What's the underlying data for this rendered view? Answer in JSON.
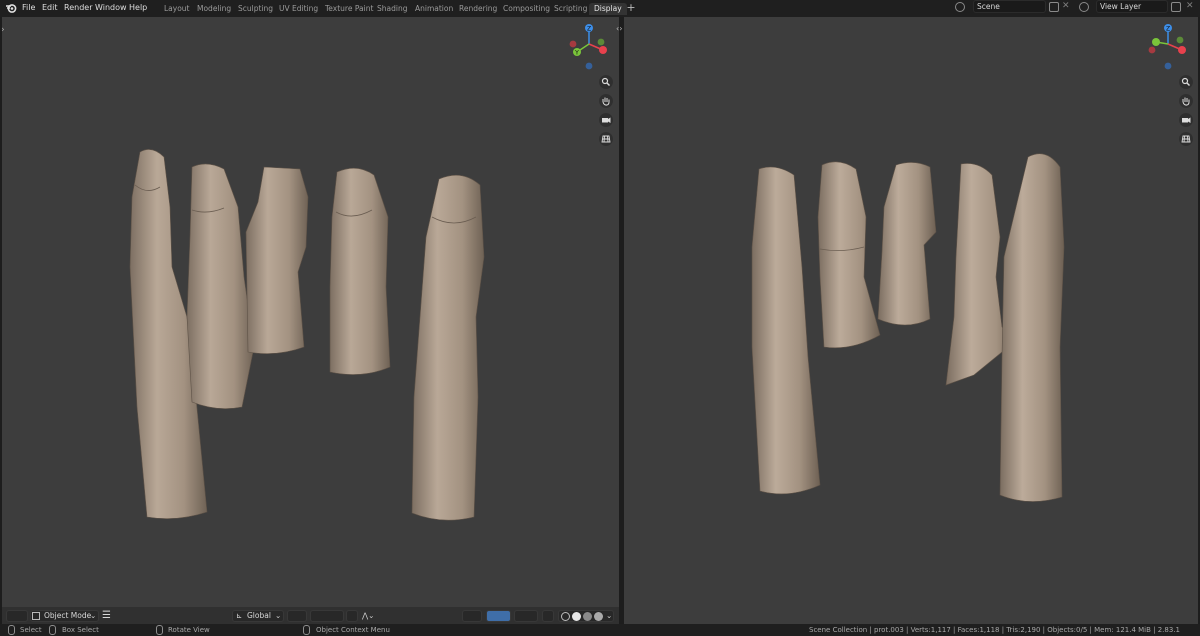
{
  "menus": [
    "File",
    "Edit",
    "Render",
    "Window",
    "Help"
  ],
  "workspaces": [
    "Layout",
    "Modeling",
    "Sculpting",
    "UV Editing",
    "Texture Paint",
    "Shading",
    "Animation",
    "Rendering",
    "Compositing",
    "Scripting",
    "Display"
  ],
  "active_workspace": "Display",
  "scene": {
    "name": "Scene"
  },
  "view_layer": {
    "name": "View Layer"
  },
  "gizmo_axes": {
    "z": "Z",
    "y": "Y"
  },
  "viewport_header": {
    "mode": "Object Mode",
    "transform_orientation": "Global"
  },
  "statusbar": {
    "select": "Select",
    "box_select": "Box Select",
    "rotate_view": "Rotate View",
    "context_menu": "Object Context Menu",
    "stats": "Scene Collection | prot.003 | Verts:1,117 | Faces:1,118 | Tris:2,190 | Objects:0/5 | Mem: 121.4 MiB | 2.83.1"
  },
  "colors": {
    "viewport_bg": "#3d3d3d",
    "axis_x": "#e8414d",
    "axis_y": "#7ac53a",
    "axis_z": "#3d8ee8",
    "finger": "#a69585"
  }
}
